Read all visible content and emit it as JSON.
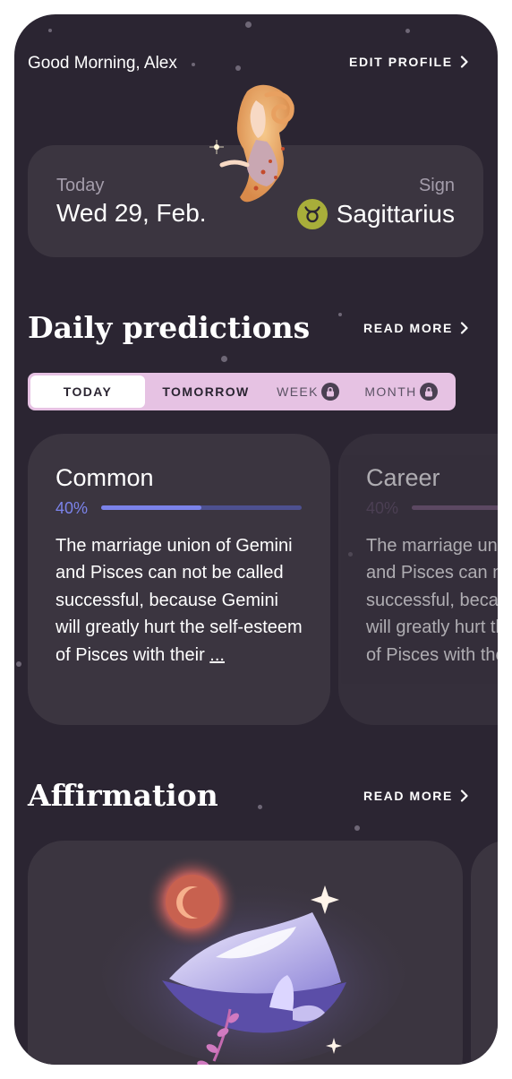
{
  "header": {
    "greeting": "Good Morning, Alex",
    "edit_profile": "EDIT PROFILE"
  },
  "today_card": {
    "date_label": "Today",
    "date_value": "Wed 29, Feb.",
    "sign_label": "Sign",
    "sign_value": "Sagittarius",
    "sign_icon": "zodiac-icon",
    "sign_icon_color": "#a8ae3a"
  },
  "daily_predictions": {
    "title": "Daily predictions",
    "read_more": "READ MORE",
    "tabs": [
      {
        "label": "TODAY",
        "active": true,
        "locked": false
      },
      {
        "label": "TOMORROW",
        "active": false,
        "locked": false
      },
      {
        "label": "WEEK",
        "active": false,
        "locked": true
      },
      {
        "label": "MONTH",
        "active": false,
        "locked": true
      }
    ],
    "cards": [
      {
        "title": "Common",
        "percent_label": "40%",
        "progress": 0.5,
        "accent": "#7b83ea",
        "text": "The marriage union of Gemini and Pisces can not be called successful, because Gemini will greatly hurt the self-esteem of Pisces with their",
        "more": "..."
      },
      {
        "title": "Career",
        "percent_label": "40%",
        "progress": 0.5,
        "accent": "#c48ac4",
        "text": "The marriage union of Gemini and Pisces can not be called successful, because Gemini will greatly hurt the self-esteem of Pisces with their",
        "more": "..."
      }
    ]
  },
  "affirmation": {
    "title": "Affirmation",
    "read_more": "READ MORE",
    "image": "moon-mountain-illustration"
  },
  "colors": {
    "background": "#2b2532",
    "card": "#3b3540",
    "tab_bar": "#e6c2e3",
    "muted_text": "#a49dab"
  }
}
